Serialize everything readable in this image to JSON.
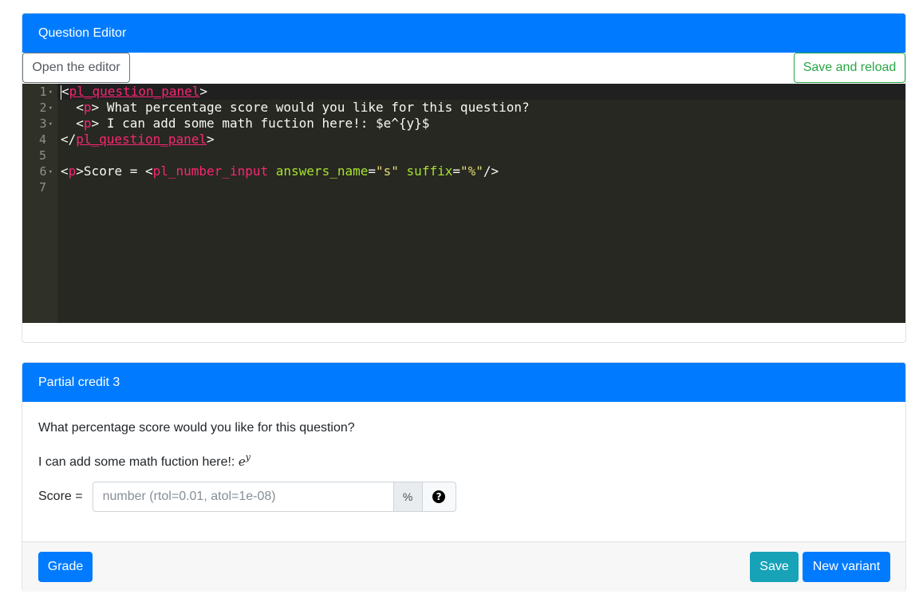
{
  "editor_card": {
    "title": "Question Editor",
    "open_editor_label": "Open the editor",
    "save_reload_label": "Save and reload",
    "line_numbers": [
      "1",
      "2",
      "3",
      "4",
      "5",
      "6",
      "7"
    ],
    "code": {
      "l1_tag": "pl_question_panel",
      "l2_tag": "p",
      "l2_text": " What percentage score would you like for this question?",
      "l3_tag": "p",
      "l3_text": " I can add some math fuction here!: $e^{y}$",
      "l4_tag": "pl_question_panel",
      "l6_tag_p": "p",
      "l6_text": "Score = ",
      "l6_tag": "pl_number_input",
      "l6_attr1": "answers_name",
      "l6_val1": "\"s\"",
      "l6_attr2": "suffix",
      "l6_val2": "\"%\""
    }
  },
  "question_card": {
    "title": "Partial credit 3",
    "question_text": "What percentage score would you like for this question?",
    "math_text": "I can add some math fuction here!: ",
    "math_base": "e",
    "math_exp": "y",
    "score_label": "Score =",
    "score_placeholder": "number (rtol=0.01, atol=1e-08)",
    "score_suffix": "%",
    "help_icon": "question-circle-icon",
    "grade_label": "Grade",
    "save_label": "Save",
    "new_variant_label": "New variant"
  },
  "colors": {
    "primary": "#007bff",
    "success": "#28a745",
    "info": "#17a2b8",
    "editor_bg": "#272822"
  }
}
